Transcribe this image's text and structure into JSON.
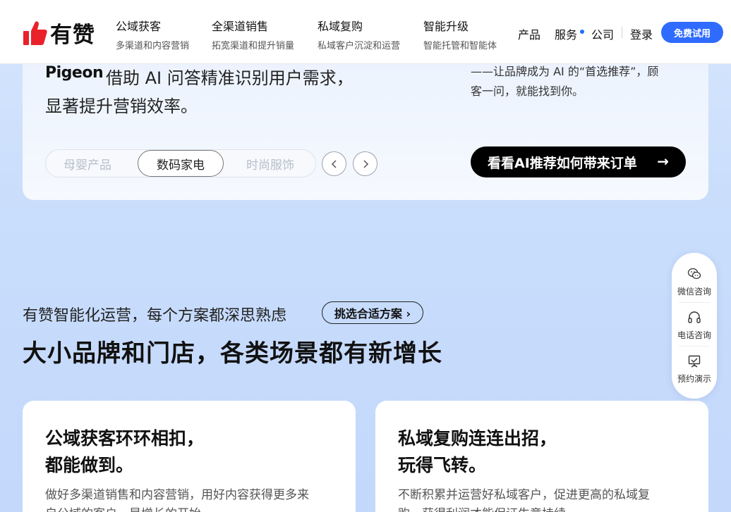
{
  "header": {
    "logo_text": "有赞",
    "nav_groups": [
      {
        "title": "公域获客",
        "subtitle": "多渠道和内容营销"
      },
      {
        "title": "全渠道销售",
        "subtitle": "拓宽渠道和提升销量"
      },
      {
        "title": "私域复购",
        "subtitle": "私域客户沉淀和运营"
      },
      {
        "title": "智能升级",
        "subtitle": "智能托管和智能体"
      }
    ],
    "nav_products": "产品",
    "nav_services": "服务",
    "nav_company": "公司",
    "login": "登录",
    "trial_button": "免费试用",
    "brand_color": "#2f6bff"
  },
  "showcase": {
    "brand_logo_text": "Pigeon",
    "quote_line1": "借助 AI 问答精准识别用户需求，",
    "quote_line2": "显著提升营销效率。",
    "right_line1": "——让品牌成为 AI 的“首选推荐”，顾",
    "right_line2": "客一问，就能找到你。",
    "categories": [
      "母婴产品",
      "数码家电",
      "时尚服饰"
    ],
    "active_category": "数码家电",
    "prev_icon": "chevron-left-icon",
    "next_icon": "chevron-right-icon",
    "cta_label": "看看AI推荐如何带来订单",
    "cta_arrow": "→"
  },
  "section": {
    "subtitle": "有赞智能化运营，每个方案都深思熟虑",
    "pill_label": "挑选合适方案 ›",
    "title": "大小品牌和门店，各类场景都有新增长"
  },
  "cards": [
    {
      "title_line1": "公域获客环环相扣，",
      "title_line2": "都能做到。",
      "text_line1": "做好多渠道销售和内容营销，用好内容获得更多来",
      "text_line2": "自公域的客户，是增长的开始。"
    },
    {
      "title_line1": "私域复购连连出招，",
      "title_line2": "玩得飞转。",
      "text_line1": "不断积累并运营好私域客户，促进更高的私域复",
      "text_line2": "购，获得利润才能保证生意持续。"
    }
  ],
  "float_widget": {
    "items": [
      {
        "label": "微信咨询",
        "icon": "wechat-icon"
      },
      {
        "label": "电话咨询",
        "icon": "headset-icon"
      },
      {
        "label": "预约演示",
        "icon": "presentation-icon"
      }
    ]
  }
}
